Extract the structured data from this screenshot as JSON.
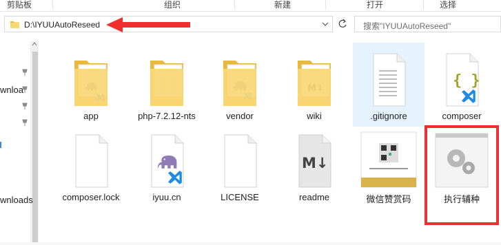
{
  "ribbon": {
    "groups": [
      "剪贴板",
      "组织",
      "新建",
      "打开",
      "选择"
    ]
  },
  "address_bar": {
    "path": "D:\\IYUUAutoReseed"
  },
  "search": {
    "placeholder": "搜索\"IYUUAutoReseed\""
  },
  "nav": {
    "items": [
      "wnloa",
      "wnloads"
    ]
  },
  "files": [
    {
      "name": "app",
      "icon": "folder-icon"
    },
    {
      "name": "php-7.2.12-nts",
      "icon": "folder-icon"
    },
    {
      "name": "vendor",
      "icon": "folder-icon"
    },
    {
      "name": "wiki",
      "icon": "folder-icon"
    },
    {
      "name": ".gitignore",
      "icon": "text-file-icon"
    },
    {
      "name": "composer",
      "icon": "json-file-icon"
    },
    {
      "name": "composer.lock",
      "icon": "blank-file-icon"
    },
    {
      "name": "iyuu.cn",
      "icon": "php-file-icon"
    },
    {
      "name": "LICENSE",
      "icon": "blank-file-icon"
    },
    {
      "name": "readme",
      "icon": "markdown-file-icon"
    },
    {
      "name": "微信赞赏码",
      "icon": "image-thumbnail-icon"
    },
    {
      "name": "执行辅种",
      "icon": "gear-batch-file-icon"
    }
  ],
  "colors": {
    "annotation_red": "#ef2f2f",
    "selected_bg": "#e5f3ff",
    "folder_yellow": "#f8d775",
    "php_purple": "#8f7bb6",
    "vscode_blue": "#1f8ae6"
  }
}
